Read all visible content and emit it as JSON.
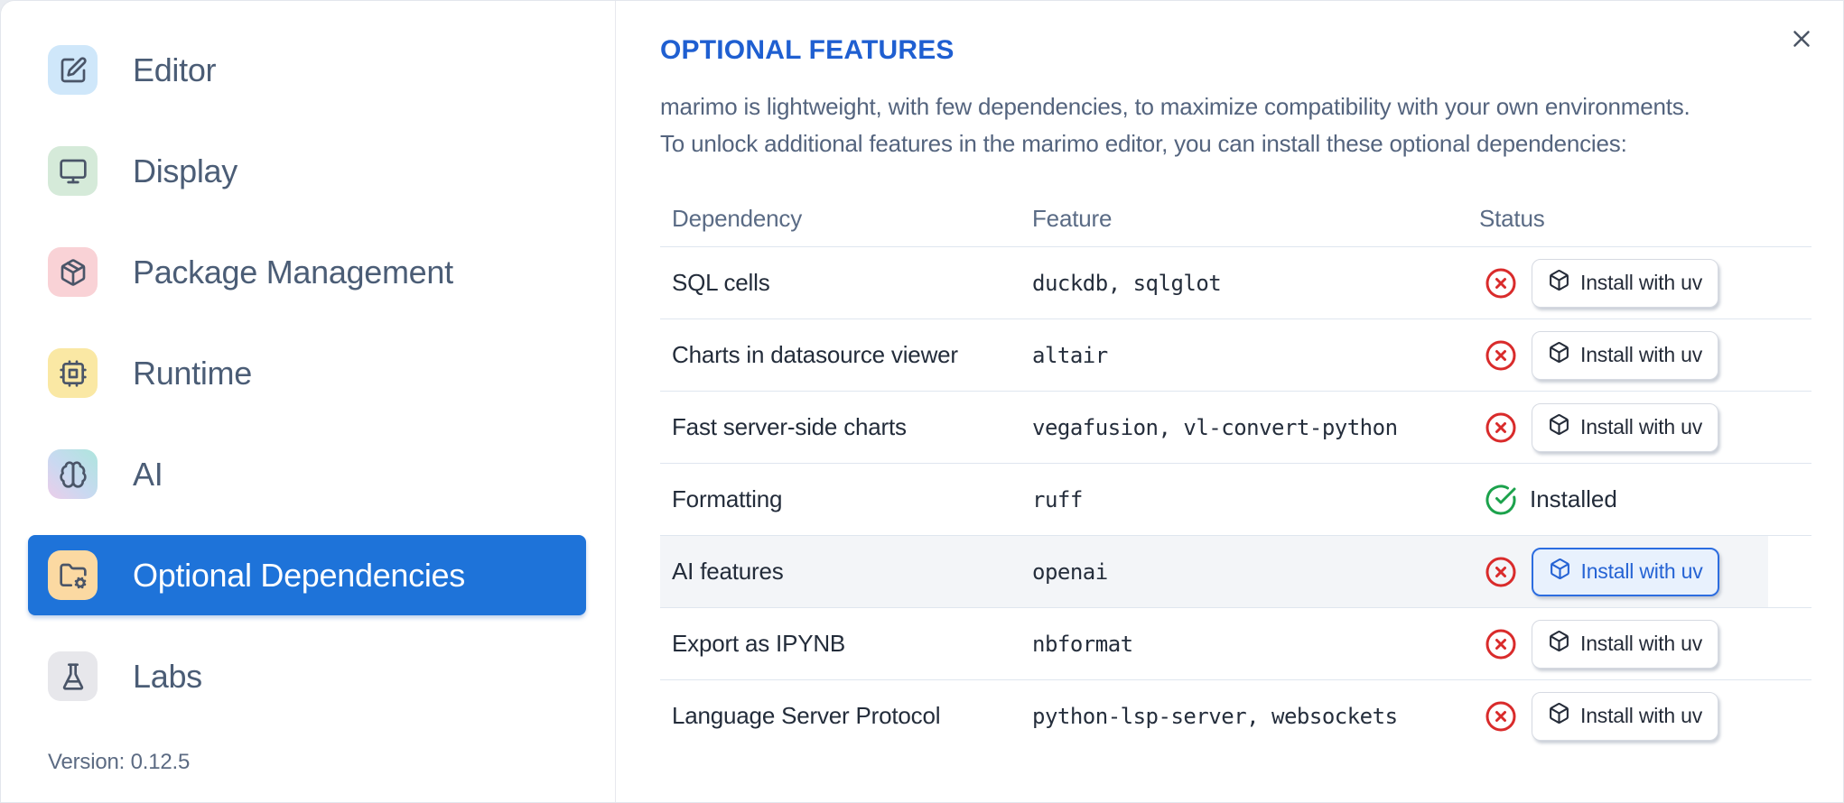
{
  "sidebar": {
    "items": [
      {
        "label": "Editor",
        "icon": "square-pen-icon",
        "icon_bg": "#cfe7fa",
        "selected": false
      },
      {
        "label": "Display",
        "icon": "monitor-icon",
        "icon_bg": "#d5ead9",
        "selected": false
      },
      {
        "label": "Package Management",
        "icon": "package-icon",
        "icon_bg": "#f9d2d6",
        "selected": false
      },
      {
        "label": "Runtime",
        "icon": "cpu-icon",
        "icon_bg": "#fae8a4",
        "selected": false
      },
      {
        "label": "AI",
        "icon": "brain-icon",
        "icon_bg": "linear-gradient(to bottom left, #ade5dd 0%, #c9d9f1 55%, #eccde9 100%)",
        "selected": false
      },
      {
        "label": "Optional Dependencies",
        "icon": "folder-cog-icon",
        "icon_bg": "#fbd9a2",
        "selected": true
      },
      {
        "label": "Labs",
        "icon": "flask-icon",
        "icon_bg": "#e7e7eb",
        "selected": false
      }
    ],
    "version": "Version: 0.12.5"
  },
  "panel": {
    "title": "OPTIONAL FEATURES",
    "description_line1": "marimo is lightweight, with few dependencies, to maximize compatibility with your own environments.",
    "description_line2": "To unlock additional features in the marimo editor, you can install these optional dependencies:",
    "close_icon": "x-icon",
    "install_button_label": "Install with uv",
    "install_button_icon": "box-icon",
    "installed_label": "Installed",
    "status_icons": {
      "not_installed": "circle-x-icon",
      "installed": "circle-check-icon"
    },
    "table": {
      "columns": [
        "Dependency",
        "Feature",
        "Status"
      ],
      "rows": [
        {
          "dependency": "SQL cells",
          "feature": "duckdb, sqlglot",
          "status": "not_installed",
          "highlighted": false
        },
        {
          "dependency": "Charts in datasource viewer",
          "feature": "altair",
          "status": "not_installed",
          "highlighted": false
        },
        {
          "dependency": "Fast server-side charts",
          "feature": "vegafusion, vl-convert-python",
          "status": "not_installed",
          "highlighted": false
        },
        {
          "dependency": "Formatting",
          "feature": "ruff",
          "status": "installed",
          "highlighted": false
        },
        {
          "dependency": "AI features",
          "feature": "openai",
          "status": "not_installed",
          "highlighted": true
        },
        {
          "dependency": "Export as IPYNB",
          "feature": "nbformat",
          "status": "not_installed",
          "highlighted": false
        },
        {
          "dependency": "Language Server Protocol",
          "feature": "python-lsp-server, websockets",
          "status": "not_installed",
          "highlighted": false
        }
      ]
    }
  },
  "colors": {
    "accent_blue": "#1e73d9",
    "title_blue": "#1f5fd1",
    "error_red": "#d92b2b",
    "success_green": "#1ca24c",
    "row_highlight": "#f3f5f8"
  }
}
